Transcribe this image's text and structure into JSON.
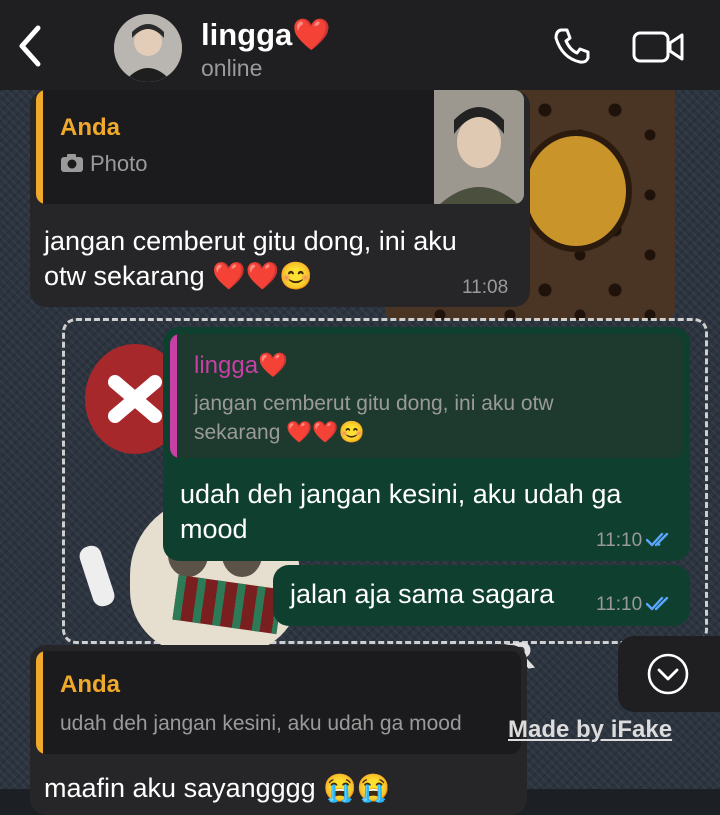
{
  "header": {
    "contact_name": "lingga❤️",
    "status": "online",
    "icons": {
      "back": "chevron-left-icon",
      "call": "phone-icon",
      "video": "video-camera-icon"
    }
  },
  "messages": [
    {
      "direction": "incoming",
      "reply": {
        "name": "Anda",
        "text": "Photo",
        "icon": "camera-icon",
        "has_thumbnail": true
      },
      "text_lines": [
        "jangan cemberut gitu dong, ini aku",
        "otw sekarang ❤️❤️😊"
      ],
      "time": "11:08"
    },
    {
      "direction": "outgoing",
      "reply": {
        "name": "lingga❤️",
        "text_lines": [
          "jangan cemberut gitu dong, ini aku otw",
          "sekarang ❤️❤️😊"
        ]
      },
      "text_lines": [
        "udah deh jangan kesini, aku udah ga",
        "mood"
      ],
      "time": "11:10",
      "read": true
    },
    {
      "direction": "outgoing",
      "text": "jalan aja sama sagara",
      "time": "11:10",
      "read": true
    },
    {
      "direction": "incoming",
      "reply": {
        "name": "Anda",
        "text": "udah deh jangan kesini, aku udah ga mood"
      },
      "text_partial": "maafin aku sayangggg 😭😭"
    }
  ],
  "scroll_button_icon": "chevron-down-circle-icon",
  "watermark": "Made by iFake",
  "colors": {
    "header_bg": "#1f1f21",
    "incoming_bubble": "#262628",
    "outgoing_bubble": "#0f3f2f",
    "reply_self_accent": "#f0a92b",
    "reply_contact_accent": "#c83fa6",
    "read_ticks": "#5aa7ff"
  }
}
